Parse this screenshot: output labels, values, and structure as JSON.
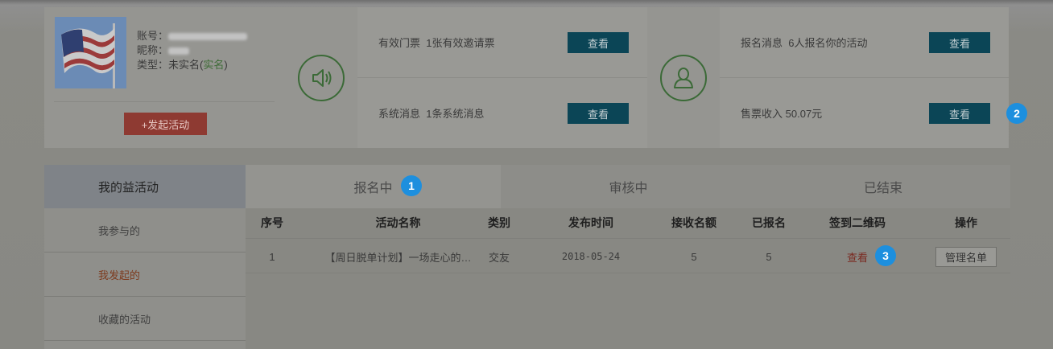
{
  "profile": {
    "account_label": "账号：",
    "account_value": "15XXXXXXXXX",
    "nickname_label": "昵称：",
    "nickname_value": "XXXX",
    "type_label": "类型：未实名(",
    "type_link": "实名",
    "type_close": ")",
    "launch_label": "+发起活动"
  },
  "tickets": {
    "valid_label": "有效门票",
    "valid_value": "1张有效邀请票",
    "system_label": "系统消息",
    "system_value": "1条系统消息"
  },
  "signup": {
    "message_label": "报名消息",
    "message_value": "6人报名你的活动",
    "revenue_label": "售票收入",
    "revenue_value": "50.07元"
  },
  "view_label": "查看",
  "badges": [
    "1",
    "2",
    "3"
  ],
  "sidebar": {
    "title": "我的益活动",
    "items": [
      {
        "label": "我参与的"
      },
      {
        "label": "我发起的"
      },
      {
        "label": "收藏的活动"
      }
    ]
  },
  "tabs": [
    {
      "label": "报名中"
    },
    {
      "label": "审核中"
    },
    {
      "label": "已结束"
    }
  ],
  "table": {
    "headers": [
      "序号",
      "活动名称",
      "类别",
      "发布时间",
      "接收名额",
      "已报名",
      "签到二维码",
      "操作"
    ],
    "rows": [
      {
        "index": "1",
        "name": "【周日脱单计划】一场走心的…",
        "category": "交友",
        "date": "2018-05-24",
        "quota": "5",
        "registered": "5",
        "qr": "查看",
        "action": "管理名单"
      }
    ]
  },
  "colors": {
    "view_button": "#0b4556",
    "launch_button": "#8e3a32",
    "icon_green": "#3b6a37",
    "badge_blue": "#1d8fde"
  },
  "icons": {
    "speaker": "speaker-icon",
    "user": "user-icon",
    "flag": "flag-avatar"
  }
}
